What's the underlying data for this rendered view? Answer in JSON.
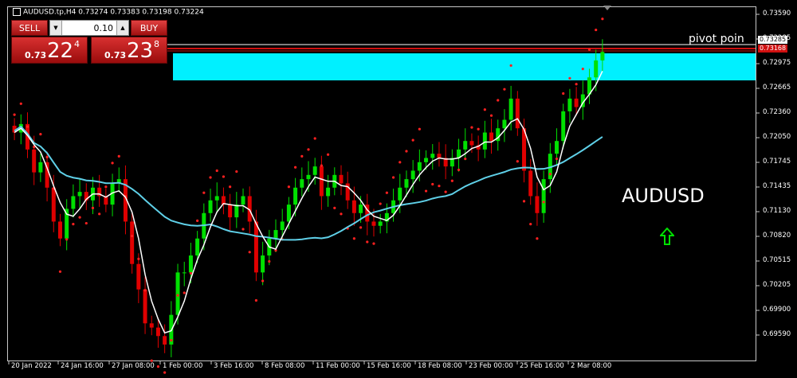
{
  "header": {
    "symbol_info": "AUDUSD.tp,H4",
    "ohlc": "0.73274 0.73383 0.73198 0.73224"
  },
  "trade_panel": {
    "sell_label": "SELL",
    "buy_label": "BUY",
    "lot_value": "0.10",
    "sell_prefix": "0.73",
    "sell_big": "22",
    "sell_sup": "4",
    "buy_prefix": "0.73",
    "buy_big": "23",
    "buy_sup": "8"
  },
  "annotations": {
    "pivot_label": "pivot poin",
    "symbol_label": "AUDUSD"
  },
  "price_axis": [
    "0.73590",
    "0.73285",
    "0.72975",
    "0.72665",
    "0.72360",
    "0.72050",
    "0.71745",
    "0.71435",
    "0.71130",
    "0.70820",
    "0.70515",
    "0.70205",
    "0.69900",
    "0.69590"
  ],
  "price_axis_top": "0.73590",
  "current_price_tag": "0.73168",
  "white_price_tag": "0.73285",
  "time_axis": [
    "20 Jan 2022",
    "24 Jan 16:00",
    "27 Jan 08:00",
    "1 Feb 00:00",
    "3 Feb 16:00",
    "8 Feb 08:00",
    "11 Feb 00:00",
    "15 Feb 16:00",
    "18 Feb 08:00",
    "23 Feb 00:00",
    "25 Feb 16:00",
    "2 Mar 08:00"
  ],
  "colors": {
    "bull": "#00e000",
    "bear": "#e00000",
    "ma_slow": "#5fd0e8",
    "ma_fast": "#ffffff",
    "sar": "#ff2020",
    "zone": "#00f0ff",
    "pivot_line": "#d01010"
  },
  "chart_data": {
    "type": "candlestick",
    "ylim": [
      0.6959,
      0.737
    ],
    "close_series": [
      0.7225,
      0.7235,
      0.7205,
      0.7178,
      0.719,
      0.716,
      0.712,
      0.71,
      0.7135,
      0.715,
      0.7155,
      0.7145,
      0.716,
      0.715,
      0.714,
      0.7165,
      0.717,
      0.712,
      0.707,
      0.704,
      0.7,
      0.6995,
      0.6985,
      0.6975,
      0.701,
      0.706,
      0.706,
      0.708,
      0.71,
      0.713,
      0.7145,
      0.715,
      0.714,
      0.7125,
      0.714,
      0.715,
      0.712,
      0.706,
      0.708,
      0.71,
      0.711,
      0.712,
      0.714,
      0.716,
      0.717,
      0.7175,
      0.7185,
      0.715,
      0.716,
      0.7175,
      0.7165,
      0.7145,
      0.713,
      0.714,
      0.712,
      0.7115,
      0.712,
      0.713,
      0.7145,
      0.716,
      0.717,
      0.718,
      0.719,
      0.7195,
      0.72,
      0.7195,
      0.7185,
      0.7195,
      0.7205,
      0.7215,
      0.721,
      0.7205,
      0.7225,
      0.7215,
      0.723,
      0.724,
      0.7265,
      0.723,
      0.718,
      0.715,
      0.713,
      0.717,
      0.72,
      0.7215,
      0.725,
      0.7265,
      0.7255,
      0.727,
      0.729,
      0.731,
      0.732
    ]
  }
}
